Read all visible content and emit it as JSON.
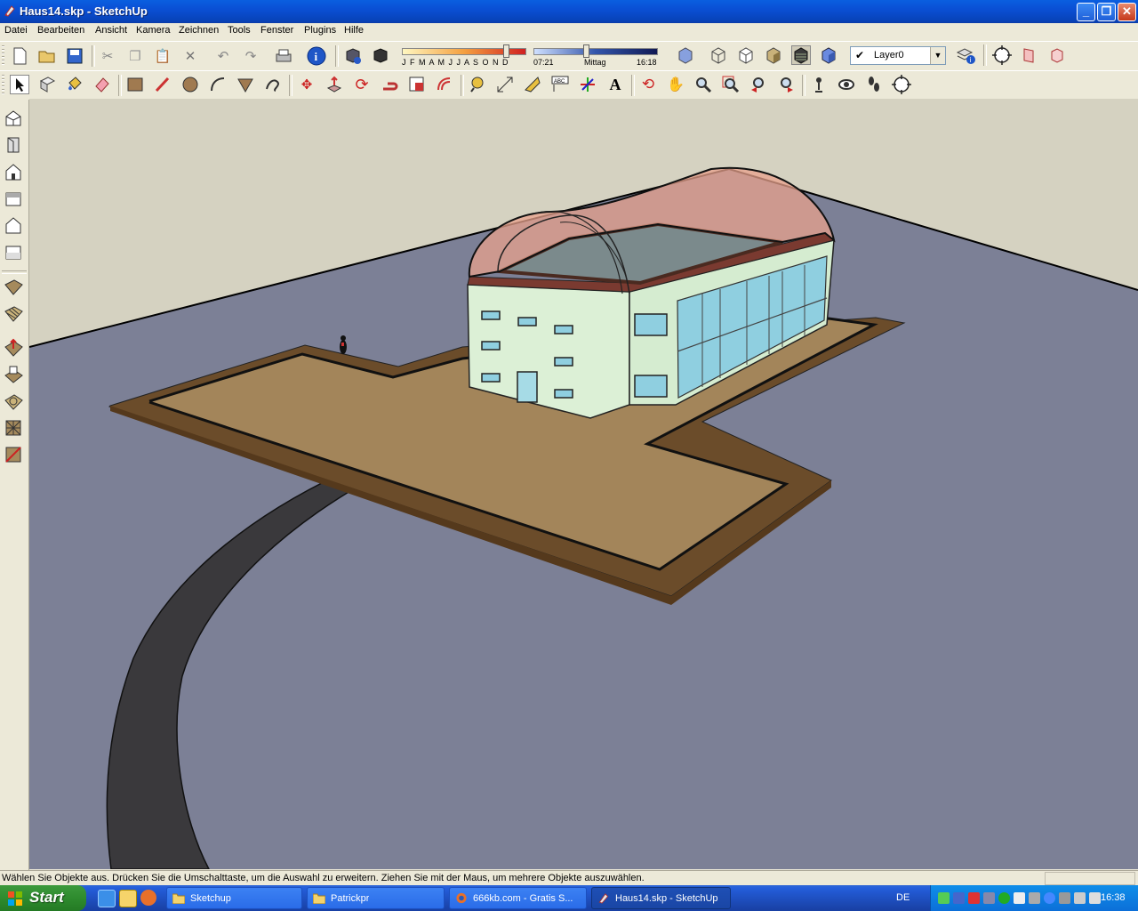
{
  "window": {
    "title": "Haus14.skp - SketchUp"
  },
  "menu": [
    "Datei",
    "Bearbeiten",
    "Ansicht",
    "Kamera",
    "Zeichnen",
    "Tools",
    "Fenster",
    "Plugins",
    "Hilfe"
  ],
  "shadow": {
    "months": "J F M A M J J A S O N D",
    "time_start": "07:21",
    "noon": "Mittag",
    "time_end": "16:18"
  },
  "layer": {
    "current": "Layer0"
  },
  "status": {
    "message": "Wählen Sie Objekte aus. Drücken Sie die Umschalttaste, um die Auswahl zu erweitern. Ziehen Sie mit der Maus, um mehrere Objekte auszuwählen."
  },
  "taskbar": {
    "start": "Start",
    "tasks": [
      {
        "label": "Sketchup"
      },
      {
        "label": "Patrickpr"
      },
      {
        "label": "666kb.com - Gratis S..."
      },
      {
        "label": "Haus14.skp - SketchUp"
      }
    ],
    "lang": "DE",
    "clock": "16:38"
  },
  "colors": {
    "sky": "#d6d3c2",
    "ground": "#7b7f95",
    "terrace": "#a0814f",
    "terrace_border": "#6b4c2a",
    "road": "#3b3a3d",
    "wall": "#dcf0d6",
    "roof_glass": "#e8a28c",
    "roof_flat": "#7b8a8c",
    "window": "#8cc8dc"
  },
  "icons": {
    "top_row1": [
      "new-icon",
      "open-icon",
      "save-icon",
      "cut-icon",
      "copy-icon",
      "paste-icon",
      "erase-icon",
      "undo-icon",
      "redo-icon",
      "print-icon",
      "model-info-icon",
      "component-icon",
      "group-icon",
      "xray-icon",
      "wireframe-icon",
      "hidden-line-icon",
      "shaded-icon",
      "shaded-texture-icon",
      "monochrome-icon",
      "layer-manager-icon",
      "orbit-icon",
      "section-plane-icon",
      "section-display-icon"
    ],
    "top_row2": [
      "select-icon",
      "make-component-icon",
      "paint-bucket-icon",
      "eraser-icon",
      "rectangle-icon",
      "line-icon",
      "circle-icon",
      "arc-icon",
      "polygon-icon",
      "freehand-icon",
      "move-icon",
      "push-pull-icon",
      "rotate-icon",
      "follow-me-icon",
      "scale-icon",
      "offset-icon",
      "tape-measure-icon",
      "dimension-icon",
      "protractor-icon",
      "text-icon",
      "axes-icon",
      "3d-text-icon",
      "orbit-icon",
      "pan-icon",
      "zoom-icon",
      "zoom-window-icon",
      "previous-view-icon",
      "next-view-icon",
      "position-camera-icon",
      "look-around-icon",
      "walk-icon",
      "zoom-extents-icon"
    ],
    "left": [
      "iso-view-icon",
      "top-view-icon",
      "front-view-icon",
      "right-view-icon",
      "back-view-icon",
      "left-view-icon",
      "sandbox-from-contours-icon",
      "sandbox-from-scratch-icon",
      "smoove-icon",
      "stamp-icon",
      "drape-icon",
      "add-detail-icon",
      "flip-edge-icon"
    ]
  }
}
